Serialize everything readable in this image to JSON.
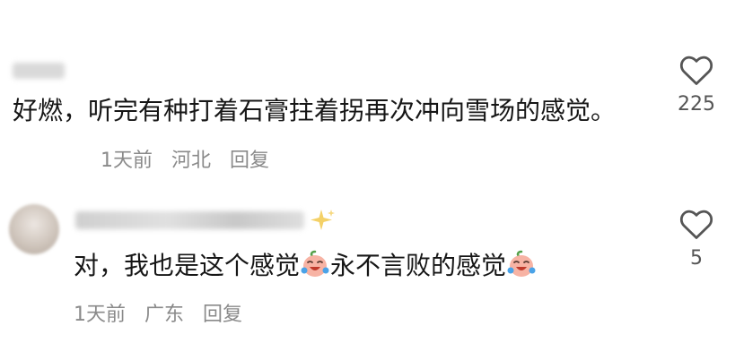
{
  "comments": [
    {
      "text": "好燃，听完有种打着石膏拄着拐再次冲向雪场的感觉。",
      "time": "1天前",
      "location": "河北",
      "reply_label": "回复",
      "like_count": "225",
      "like_icon": "heart-outline-icon"
    },
    {
      "text_part1": "对，我也是这个感觉",
      "text_part2": "永不言败的感觉",
      "emoji_icon": "crying-laughing-emoji-icon",
      "time": "1天前",
      "location": "广东",
      "reply_label": "回复",
      "like_count": "5",
      "like_icon": "heart-outline-icon"
    }
  ],
  "colors": {
    "text": "#161616",
    "meta": "#8a8a8a",
    "count": "#555555"
  }
}
